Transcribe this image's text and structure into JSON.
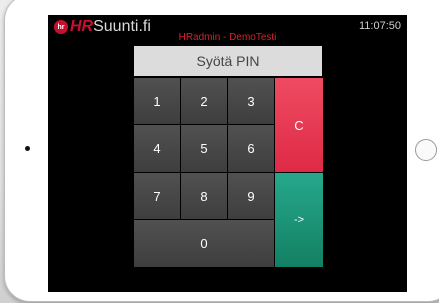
{
  "header": {
    "logo_mark": "hr",
    "logo_hr": "HR",
    "logo_rest": "Suunti.fi",
    "time": "11:07:50",
    "subtitle": "HRadmin - DemoTesti"
  },
  "pin": {
    "placeholder": "Syötä PIN"
  },
  "keypad": {
    "k1": "1",
    "k2": "2",
    "k3": "3",
    "k4": "4",
    "k5": "5",
    "k6": "6",
    "k7": "7",
    "k8": "8",
    "k9": "9",
    "k0": "0",
    "clear": "C",
    "enter": "->"
  },
  "colors": {
    "brand_red": "#c8102e",
    "clear_button": "#e8354e",
    "enter_button": "#1d937a",
    "key_gray": "#474747"
  }
}
